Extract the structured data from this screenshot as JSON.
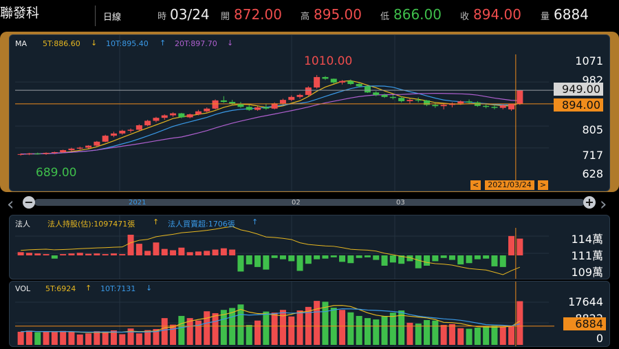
{
  "header": {
    "stock_name": "聯發科",
    "period": "日線",
    "time_label": "時",
    "time_value": "03/24",
    "open_label": "開",
    "open_value": "872.00",
    "high_label": "高",
    "high_value": "895.00",
    "low_label": "低",
    "low_value": "866.00",
    "close_label": "收",
    "close_value": "894.00",
    "volume_label": "量",
    "volume_value": "6884"
  },
  "main_panel": {
    "ma_label": "MA",
    "ma5": "5T:886.60",
    "ma10": "10T:895.40",
    "ma20": "20T:897.70",
    "ma5_arrow": "↓",
    "ma10_arrow": "↑",
    "ma20_arrow": "↓",
    "high_marker": "1010.00",
    "low_marker": "689.00",
    "axis": [
      "1071",
      "982",
      "805",
      "717",
      "628"
    ],
    "cursor_price": "949.00",
    "last_price": "894.00",
    "cursor_date": "2021/03/24",
    "prev_btn": "<",
    "next_btn": ">"
  },
  "timeline": {
    "labels": [
      "2021",
      "02",
      "03"
    ],
    "zoom_out": "−",
    "zoom_in": "+",
    "left_arrow": "‹",
    "right_arrow": "›"
  },
  "inst_panel": {
    "label": "法人",
    "holding": "法人持股(估):1097471張",
    "holding_arrow": "↑",
    "net": "法人買賣超:1706張",
    "net_arrow": "↑",
    "axis": [
      "114萬",
      "111萬",
      "109萬"
    ]
  },
  "vol_panel": {
    "label": "VOL",
    "ma5": "5T:6924",
    "ma5_arrow": "↑",
    "ma10": "10T:7131",
    "ma10_arrow": "↓",
    "axis": [
      "17644",
      "8822",
      "0"
    ],
    "current": "6884"
  },
  "colors": {
    "up": "#ef4d4d",
    "down": "#3fbf4b",
    "ma5": "#e8b820",
    "ma10": "#3a9ae8",
    "ma20": "#b060d0",
    "accent": "#f08c1c"
  },
  "chart_data": [
    {
      "type": "candlestick",
      "title": "",
      "ylim": [
        628,
        1071
      ],
      "series": [
        {
          "name": "OHLC",
          "values": [
            [
              690,
              695,
              686,
              692
            ],
            [
              692,
              697,
              688,
              694
            ],
            [
              694,
              698,
              690,
              693
            ],
            [
              693,
              699,
              689,
              697
            ],
            [
              697,
              702,
              692,
              700
            ],
            [
              700,
              710,
              697,
              708
            ],
            [
              708,
              718,
              704,
              714
            ],
            [
              714,
              722,
              710,
              718
            ],
            [
              718,
              728,
              714,
              726
            ],
            [
              726,
              745,
              722,
              742
            ],
            [
              742,
              770,
              740,
              766
            ],
            [
              766,
              782,
              760,
              775
            ],
            [
              775,
              790,
              770,
              786
            ],
            [
              786,
              795,
              778,
              790
            ],
            [
              790,
              812,
              786,
              808
            ],
            [
              808,
              830,
              804,
              826
            ],
            [
              826,
              842,
              820,
              838
            ],
            [
              838,
              852,
              830,
              848
            ],
            [
              848,
              860,
              842,
              856
            ],
            [
              856,
              858,
              836,
              840
            ],
            [
              840,
              855,
              836,
              852
            ],
            [
              852,
              870,
              848,
              864
            ],
            [
              864,
              880,
              860,
              875
            ],
            [
              875,
              912,
              872,
              908
            ],
            [
              908,
              925,
              898,
              902
            ],
            [
              902,
              910,
              890,
              895
            ],
            [
              895,
              902,
              878,
              882
            ],
            [
              882,
              890,
              866,
              870
            ],
            [
              870,
              884,
              866,
              880
            ],
            [
              880,
              895,
              870,
              875
            ],
            [
              875,
              900,
              872,
              896
            ],
            [
              896,
              915,
              890,
              910
            ],
            [
              910,
              928,
              905,
              922
            ],
            [
              922,
              935,
              915,
              930
            ],
            [
              930,
              965,
              926,
              960
            ],
            [
              960,
              1010,
              955,
              1002
            ],
            [
              1002,
              1006,
              990,
              995
            ],
            [
              995,
              996,
              975,
              980
            ],
            [
              980,
              990,
              972,
              986
            ],
            [
              986,
              992,
              970,
              974
            ],
            [
              974,
              980,
              960,
              965
            ],
            [
              965,
              966,
              938,
              940
            ],
            [
              940,
              945,
              925,
              930
            ],
            [
              930,
              935,
              918,
              922
            ],
            [
              922,
              930,
              912,
              918
            ],
            [
              918,
              924,
              900,
              905
            ],
            [
              905,
              915,
              896,
              910
            ],
            [
              910,
              920,
              900,
              908
            ],
            [
              908,
              910,
              885,
              890
            ],
            [
              890,
              900,
              878,
              885
            ],
            [
              885,
              895,
              872,
              890
            ],
            [
              890,
              900,
              880,
              896
            ],
            [
              896,
              908,
              890,
              904
            ],
            [
              904,
              912,
              895,
              900
            ],
            [
              900,
              905,
              882,
              886
            ],
            [
              886,
              895,
              876,
              882
            ],
            [
              882,
              890,
              872,
              878
            ],
            [
              878,
              892,
              872,
              888
            ],
            [
              872,
              895,
              866,
              894
            ],
            [
              894,
              950,
              890,
              949
            ]
          ]
        }
      ]
    },
    {
      "type": "bar",
      "title": "",
      "series": [
        {
          "name": "法人買賣超",
          "values": [
            500,
            400,
            300,
            200,
            -500,
            200,
            300,
            400,
            250,
            300,
            200,
            300,
            200,
            3200,
            1800,
            700,
            2000,
            1000,
            800,
            1200,
            500,
            600,
            700,
            900,
            1100,
            900,
            -2500,
            -1400,
            -1800,
            -2200,
            -400,
            -600,
            -900,
            -2400,
            -1300,
            -600,
            -500,
            -300,
            -1000,
            -1200,
            -400,
            -300,
            -700,
            -1600,
            -1100,
            -1300,
            -900,
            -2000,
            -1600,
            -900,
            -400,
            -700,
            -1400,
            -1200,
            -600,
            -500,
            -1700,
            -1800,
            3000,
            2600
          ]
        }
      ]
    },
    {
      "type": "bar",
      "title": "",
      "ylim": [
        0,
        17644
      ],
      "series": [
        {
          "name": "VOL",
          "values": [
            4800,
            5200,
            4600,
            4900,
            4700,
            5100,
            4800,
            3800,
            4200,
            5000,
            4900,
            5300,
            3900,
            6000,
            4200,
            5400,
            5800,
            9800,
            7400,
            10600,
            9800,
            8900,
            12300,
            11600,
            12800,
            13500,
            14800,
            7300,
            8900,
            12200,
            11800,
            12800,
            10400,
            12600,
            13900,
            16100,
            15800,
            13600,
            12800,
            11900,
            10600,
            9800,
            9300,
            10600,
            11800,
            12600,
            8100,
            7800,
            9100,
            8900,
            7300,
            7600,
            6100,
            5900,
            6300,
            6900,
            7100,
            6700,
            6884,
            16000
          ]
        }
      ]
    }
  ]
}
